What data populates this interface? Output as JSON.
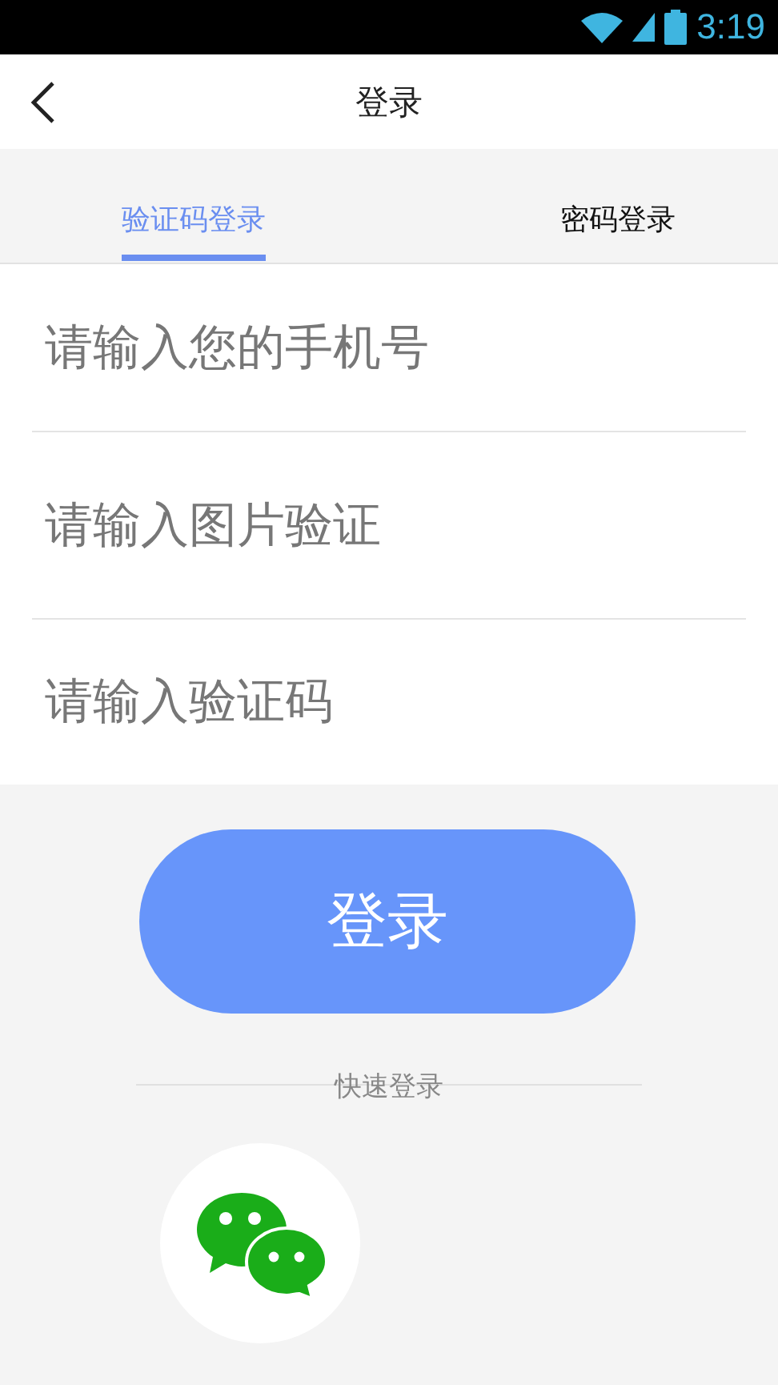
{
  "status_bar": {
    "time": "3:19"
  },
  "header": {
    "title": "登录"
  },
  "tabs": [
    {
      "label": "验证码登录",
      "selected": true
    },
    {
      "label": "密码登录",
      "selected": false
    }
  ],
  "fields": [
    {
      "placeholder": "请输入您的手机号"
    },
    {
      "placeholder": "请输入图片验证"
    },
    {
      "placeholder": "请输入验证码"
    }
  ],
  "login_button": {
    "label": "登录"
  },
  "quick_login": {
    "label": "快速登录"
  }
}
